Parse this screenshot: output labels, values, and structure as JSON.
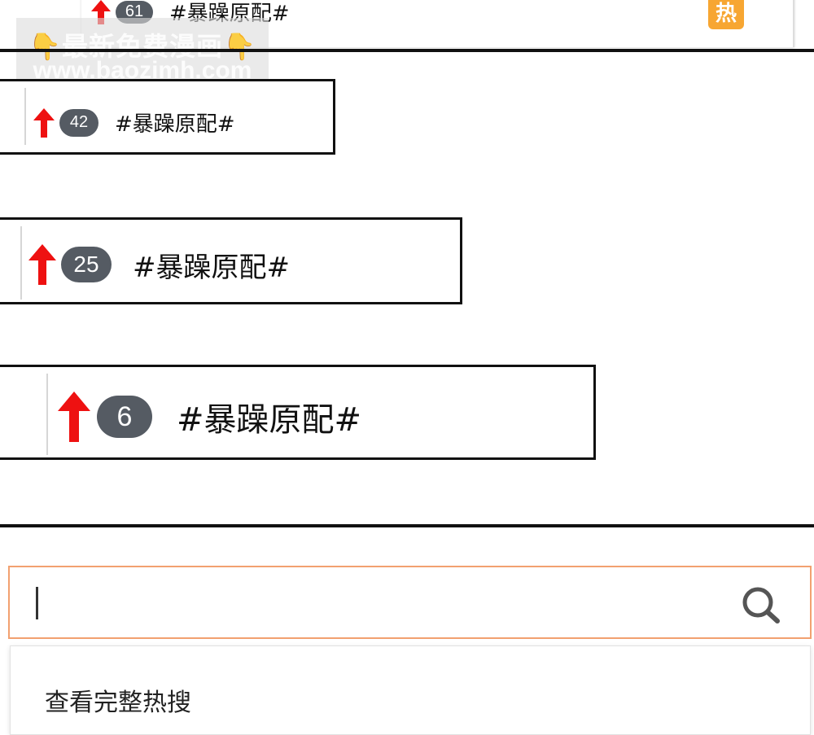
{
  "watermark": {
    "line1": "👇最新免费漫画👇",
    "line2": "www.baozimh.com"
  },
  "hot_badge": "热",
  "trends": [
    {
      "rank": "61",
      "tag": "#暴躁原配#"
    },
    {
      "rank": "42",
      "tag": "#暴躁原配#"
    },
    {
      "rank": "25",
      "tag": "#暴躁原配#"
    },
    {
      "rank": "6",
      "tag": "#暴躁原配#"
    }
  ],
  "search": {
    "value": "",
    "placeholder": ""
  },
  "suggestion": {
    "label": "查看完整热搜"
  },
  "colors": {
    "arrow": "#ee1111",
    "pill": "#555b63",
    "search_border": "#f2a170",
    "hot": "#f7a632"
  }
}
